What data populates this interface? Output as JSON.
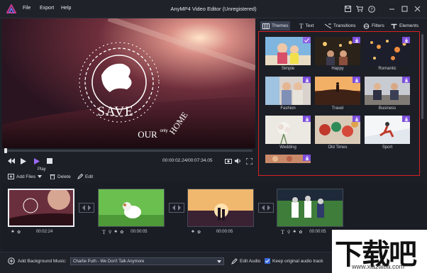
{
  "window": {
    "title": "AnyMP4 Video Editor (Unregistered)",
    "menu": [
      "File",
      "Export",
      "Help"
    ]
  },
  "player": {
    "timecode": "00:00:02.24/00:07:34.05",
    "tooltip": "Play",
    "preview_text": {
      "save": "SAVE",
      "our": "OUR",
      "only": "only",
      "home": "HOME"
    }
  },
  "edit_toolbar": {
    "add_files": "Add Files",
    "delete": "Delete",
    "edit": "Edit"
  },
  "panel": {
    "tabs": [
      "Themes",
      "Text",
      "Transitions",
      "Filters",
      "Elements"
    ],
    "active_tab": "Themes",
    "themes": [
      "Simple",
      "Happy",
      "Romantic",
      "Fashion",
      "Travel",
      "Business",
      "Wedding",
      "Old Times",
      "Sport"
    ]
  },
  "timeline": {
    "clips": [
      {
        "duration": "00:02:24"
      },
      {
        "duration": "00:00:05"
      },
      {
        "duration": "00:00:05"
      },
      {
        "duration": "00:00:05"
      }
    ]
  },
  "bottom": {
    "bg_music_label": "Add Background Music:",
    "music_value": "Charlie Puth - We Don't Talk Anymore",
    "edit_audio": "Edit Audio",
    "keep_audio": "Keep original audio track",
    "keep_audio_checked": true
  },
  "watermark": {
    "text": "下载吧",
    "url": "www.xiazaiba.com"
  },
  "colors": {
    "accent": "#7b4ddb",
    "highlight": "#d62027",
    "background": "#1c1f26"
  }
}
